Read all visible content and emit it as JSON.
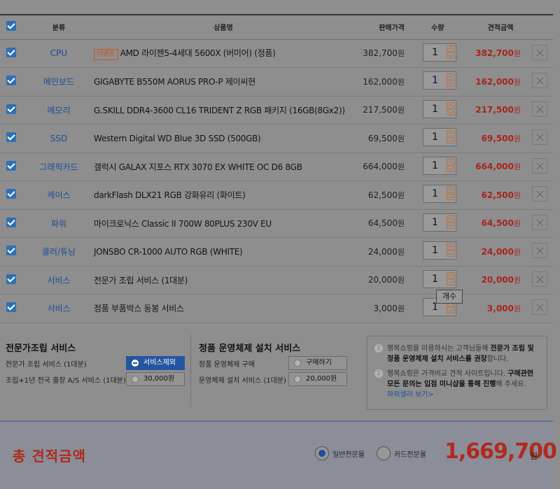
{
  "header": {
    "category": "분류",
    "product": "상품명",
    "price": "판매가격",
    "qty": "수량",
    "total": "견적금액"
  },
  "rows": [
    {
      "category": "CPU",
      "tag": "이벤트",
      "name": "AMD 라이젠5-4세대 5600X (버미어) (정품)",
      "price": "382,700",
      "qty": "1",
      "total": "382,700"
    },
    {
      "category": "메인보드",
      "tag": "",
      "name": "GIGABYTE B550M AORUS PRO-P 제이씨현",
      "price": "162,000",
      "qty": "1",
      "total": "162,000"
    },
    {
      "category": "메모리",
      "tag": "",
      "name": "G.SKILL DDR4-3600 CL16 TRIDENT Z RGB 패키지 (16GB(8Gx2))",
      "price": "217,500",
      "qty": "1",
      "total": "217,500"
    },
    {
      "category": "SSD",
      "tag": "",
      "name": "Western Digital WD Blue 3D SSD (500GB)",
      "price": "69,500",
      "qty": "1",
      "total": "69,500"
    },
    {
      "category": "그래픽카드",
      "tag": "",
      "name": "갤럭시 GALAX 지포스 RTX 3070 EX WHITE OC D6 8GB",
      "price": "664,000",
      "qty": "1",
      "total": "664,000"
    },
    {
      "category": "케이스",
      "tag": "",
      "name": "darkFlash DLX21 RGB 강화유리 (화이트)",
      "price": "62,500",
      "qty": "1",
      "total": "62,500"
    },
    {
      "category": "파워",
      "tag": "",
      "name": "마이크로닉스 Classic II 700W 80PLUS 230V EU",
      "price": "64,500",
      "qty": "1",
      "total": "64,500"
    },
    {
      "category": "쿨러/튜닝",
      "tag": "",
      "name": "JONSBO CR-1000 AUTO RGB (WHITE)",
      "price": "24,000",
      "qty": "1",
      "total": "24,000"
    },
    {
      "category": "서비스",
      "tag": "",
      "name": "전문가 조립 서비스 (1대분)",
      "price": "20,000",
      "qty": "1",
      "total": "20,000"
    },
    {
      "category": "서비스",
      "tag": "",
      "name": "정품 부품박스 동봉 서비스",
      "price": "3,000",
      "qty": "1",
      "total": "3,000"
    }
  ],
  "won": "원",
  "tooltip": "개수",
  "services": {
    "expert": {
      "title": "전문가조립 서비스",
      "row1_label": "전문가 조립 서비스 (1대분)",
      "row1_button": "서비스제외",
      "row2_label": "조립+1년 전국 출장 A/S 서비스 (1대분)",
      "row2_button": "30,000원"
    },
    "os": {
      "title": "정품 운영체제 설치 서비스",
      "row1_label": "정품 운영체제 구매",
      "row1_button": "구매하기",
      "row2_label": "운영체제 설치 서비스 (1대분)",
      "row2_button": "20,000원"
    },
    "notes": {
      "n1_num": "1",
      "n1_pre": "행복쇼핑을 이용하시는 고객님들께 ",
      "n1_bold": "전문가 조립 및 정품 운영체제 설치 서비스를 권장",
      "n1_post": "합니다.",
      "n2_num": "2",
      "n2_pre": "행복쇼핑은 가격비교 견적 사이트입니다. ",
      "n2_bold": "구매관련 모든 문의는 입점 미니샵을 통해 진행",
      "n2_post": "해 주세요.",
      "link": "파워셀러 보기>"
    }
  },
  "footer": {
    "label": "총 견적금액",
    "radio1": "일반전문몰",
    "radio2": "카드전문몰",
    "grand_total": "1,669,700",
    "won": "원"
  },
  "colors": {
    "accent_blue": "#2f6fb3",
    "price_red": "#a8241d",
    "category_blue": "#1b4d9a"
  }
}
